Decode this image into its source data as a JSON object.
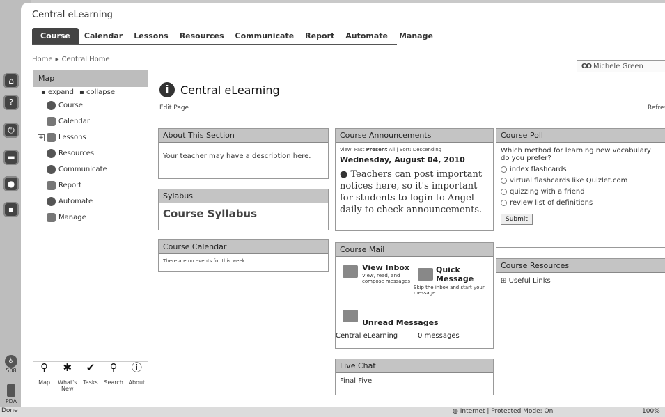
{
  "app": {
    "title": "Central eLearning"
  },
  "nav": {
    "tabs": [
      {
        "label": "Course"
      },
      {
        "label": "Calendar"
      },
      {
        "label": "Lessons"
      },
      {
        "label": "Resources"
      },
      {
        "label": "Communicate"
      },
      {
        "label": "Report"
      },
      {
        "label": "Automate"
      },
      {
        "label": "Manage"
      }
    ]
  },
  "breadcrumb": {
    "home": "Home",
    "sep": "▸",
    "current": "Central Home"
  },
  "user": {
    "name": "Michele Green"
  },
  "map": {
    "title": "Map",
    "expand": "expand",
    "collapse": "collapse",
    "items": [
      {
        "label": "Course"
      },
      {
        "label": "Calendar"
      },
      {
        "label": "Lessons"
      },
      {
        "label": "Resources"
      },
      {
        "label": "Communicate"
      },
      {
        "label": "Report"
      },
      {
        "label": "Automate"
      },
      {
        "label": "Manage"
      }
    ],
    "tools": [
      {
        "label": "Map"
      },
      {
        "label": "What's New"
      },
      {
        "label": "Tasks"
      },
      {
        "label": "Search"
      },
      {
        "label": "About"
      }
    ]
  },
  "rail": {
    "label_508": "508",
    "label_pda": "PDA"
  },
  "page": {
    "title": "Central eLearning",
    "edit": "Edit Page",
    "refresh": "Refres"
  },
  "about": {
    "title": "About This Section",
    "body": "Your teacher may have a description here."
  },
  "syllabus": {
    "title": "Sylabus",
    "link": "Course Syllabus"
  },
  "calendar": {
    "title": "Course Calendar",
    "body": "There are no events for this week."
  },
  "announcements": {
    "title": "Course Announcements",
    "view_prefix": "View: Past",
    "view_present": "Present",
    "view_all": "All",
    "sort": "| Sort: Descending",
    "date": "Wednesday, August 04, 2010",
    "text": "Teachers can post important notices here, so it's important for students to login to Angel daily to check announcements."
  },
  "mail": {
    "title": "Course Mail",
    "inbox_label": "View Inbox",
    "inbox_sub": "View, read, and compose messages",
    "quick_label": "Quick Message",
    "quick_sub": "Skip the inbox and start your message.",
    "unread_label": "Unread Messages",
    "course": "Central eLearning",
    "count": "0 messages"
  },
  "chat": {
    "title": "Live Chat",
    "body": "Final Five"
  },
  "poll": {
    "title": "Course Poll",
    "question": "Which method for learning new vocabulary do you prefer?",
    "options": [
      "index flashcards",
      "virtual flashcards like Quizlet.com",
      "quizzing with a friend",
      "review list of definitions"
    ],
    "submit": "Submit"
  },
  "resources": {
    "title": "Course Resources",
    "link": "Useful Links"
  },
  "status": {
    "left": "Done",
    "zone": "Internet | Protected Mode: On",
    "zoom": "100%"
  }
}
